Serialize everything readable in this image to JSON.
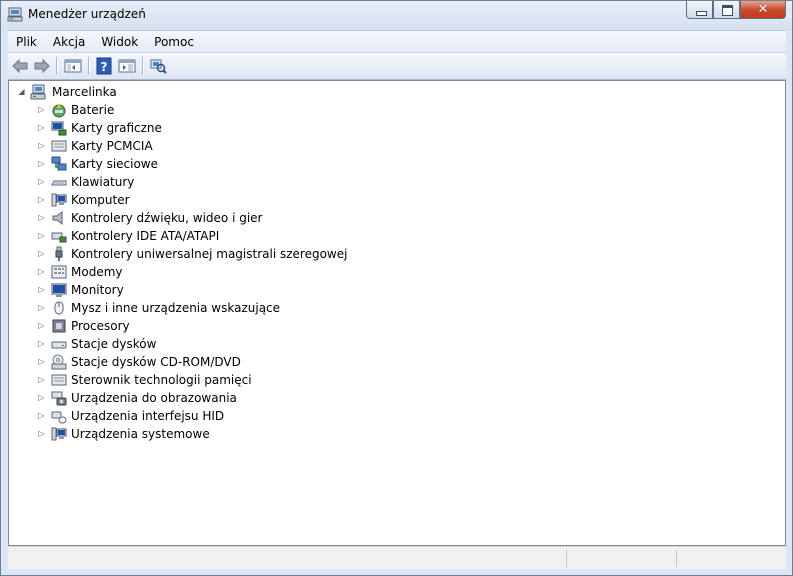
{
  "window": {
    "title": "Menedżer urządzeń",
    "close_glyph": "✕"
  },
  "menu": {
    "items": [
      "Plik",
      "Akcja",
      "Widok",
      "Pomoc"
    ]
  },
  "toolbar": {
    "icons": [
      "back-arrow-icon",
      "forward-arrow-icon",
      "show-hide-console-tree-icon",
      "help-icon",
      "properties-icon",
      "scan-hardware-changes-icon"
    ]
  },
  "tree": {
    "expanded_glyph": "◢",
    "collapsed_glyph": "▷",
    "root": {
      "label": "Marcelinka",
      "icon": "computer-root-icon"
    },
    "items": [
      {
        "label": "Baterie",
        "icon": "battery-icon"
      },
      {
        "label": "Karty graficzne",
        "icon": "display-adapter-icon"
      },
      {
        "label": "Karty PCMCIA",
        "icon": "pcmcia-card-icon"
      },
      {
        "label": "Karty sieciowe",
        "icon": "network-adapter-icon"
      },
      {
        "label": "Klawiatury",
        "icon": "keyboard-icon"
      },
      {
        "label": "Komputer",
        "icon": "computer-icon"
      },
      {
        "label": "Kontrolery dźwięku, wideo i gier",
        "icon": "speaker-icon"
      },
      {
        "label": "Kontrolery IDE ATA/ATAPI",
        "icon": "ide-controller-icon"
      },
      {
        "label": "Kontrolery uniwersalnej magistrali szeregowej",
        "icon": "usb-plug-icon"
      },
      {
        "label": "Modemy",
        "icon": "modem-icon"
      },
      {
        "label": "Monitory",
        "icon": "monitor-icon"
      },
      {
        "label": "Mysz i inne urządzenia wskazujące",
        "icon": "mouse-icon"
      },
      {
        "label": "Procesory",
        "icon": "processor-icon"
      },
      {
        "label": "Stacje dysków",
        "icon": "disk-drive-icon"
      },
      {
        "label": "Stacje dysków CD-ROM/DVD",
        "icon": "cd-rom-icon"
      },
      {
        "label": "Sterownik technologii pamięci",
        "icon": "memory-technology-icon"
      },
      {
        "label": "Urządzenia do obrazowania",
        "icon": "imaging-device-icon"
      },
      {
        "label": "Urządzenia interfejsu HID",
        "icon": "hid-device-icon"
      },
      {
        "label": "Urządzenia systemowe",
        "icon": "system-device-icon"
      }
    ]
  }
}
